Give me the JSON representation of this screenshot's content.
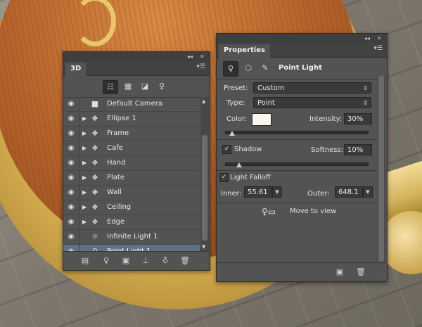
{
  "panel3d": {
    "tab_label": "3D",
    "window_controls": {
      "collapse": "◂◂",
      "close": "✕"
    },
    "menu_icon": "panel-menu-icon",
    "toolbar_icons": [
      "scene-filter-icon",
      "mesh-filter-icon",
      "material-filter-icon",
      "light-filter-icon"
    ],
    "rows": [
      {
        "label": "Default Camera",
        "icon": "camera-icon",
        "expandable": false,
        "visible": true
      },
      {
        "label": "Ellipse 1",
        "icon": "mesh-icon",
        "expandable": true,
        "visible": true
      },
      {
        "label": "Frame",
        "icon": "mesh-icon",
        "expandable": true,
        "visible": true
      },
      {
        "label": "Cafe",
        "icon": "mesh-icon",
        "expandable": true,
        "visible": true
      },
      {
        "label": "Hand",
        "icon": "mesh-icon",
        "expandable": true,
        "visible": true
      },
      {
        "label": "Plate",
        "icon": "mesh-icon",
        "expandable": true,
        "visible": true
      },
      {
        "label": "Wall",
        "icon": "mesh-icon",
        "expandable": true,
        "visible": true
      },
      {
        "label": "Ceiling",
        "icon": "mesh-icon",
        "expandable": true,
        "visible": true
      },
      {
        "label": "Edge",
        "icon": "mesh-icon",
        "expandable": true,
        "visible": true
      },
      {
        "label": "Infinite Light 1",
        "icon": "infinite-light-icon",
        "expandable": false,
        "visible": true
      },
      {
        "label": "Point Light 1",
        "icon": "point-light-icon",
        "expandable": false,
        "visible": true,
        "selected": true
      }
    ],
    "bottom_icons": [
      "render-icon",
      "add-light-icon",
      "new-object-icon",
      "ground-icon",
      "delete-light-icon",
      "trash-icon"
    ]
  },
  "properties": {
    "tab_label": "Properties",
    "window_controls": {
      "collapse": "◂◂",
      "close": "✕"
    },
    "title": "Point Light",
    "preset_label": "Preset:",
    "preset_value": "Custom",
    "type_label": "Type:",
    "type_value": "Point",
    "color_label": "Color:",
    "light_color": "#fdf6ee",
    "intensity_label": "Intensity:",
    "intensity_value": "30%",
    "shadow_label": "Shadow",
    "shadow_checked": true,
    "softness_label": "Softness:",
    "softness_value": "10%",
    "light_falloff_label": "Light Falloff",
    "light_falloff_checked": true,
    "inner_label": "Inner:",
    "inner_value": "55.61 p",
    "outer_label": "Outer:",
    "outer_value": "648.1 p",
    "move_to_view_label": "Move to view",
    "intensity_slider_fraction": 0.05,
    "softness_slider_fraction": 0.1
  },
  "colors": {
    "panel_bg": "#535353",
    "selection": "#5f7087"
  }
}
